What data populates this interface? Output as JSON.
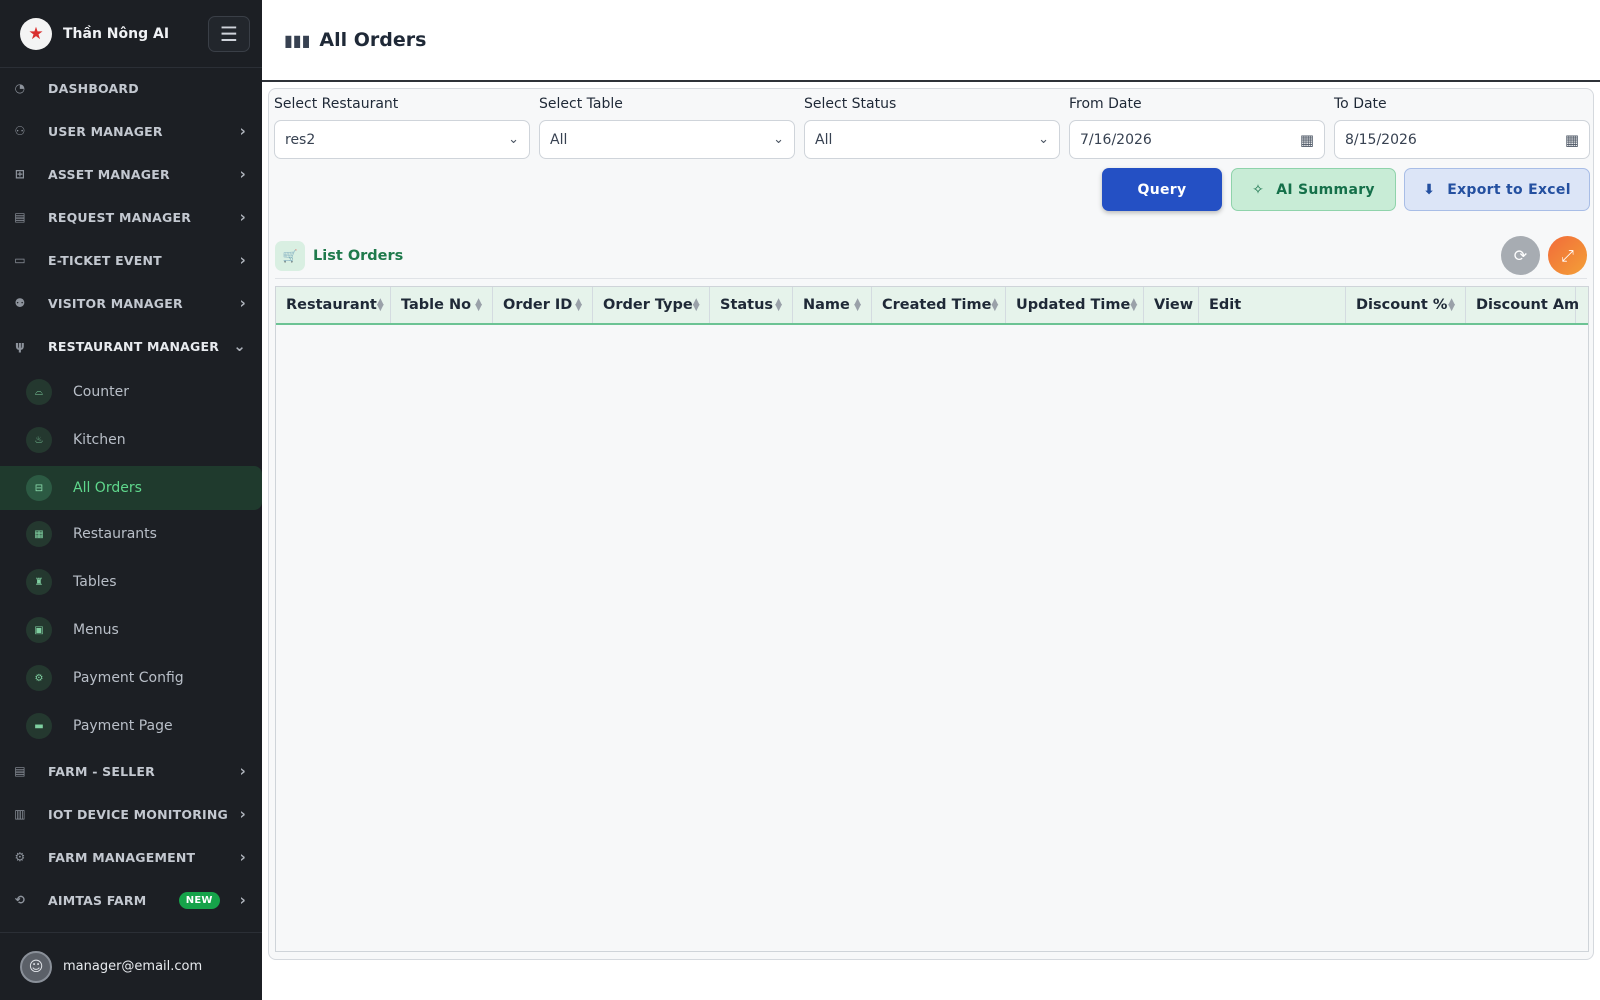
{
  "app": {
    "brand": "Thần Nông AI",
    "menu_icon": "hamburger-icon"
  },
  "sidebar": {
    "items": [
      {
        "label": "DASHBOARD",
        "icon": "dashboard-icon",
        "chevron": ""
      },
      {
        "label": "USER MANAGER",
        "icon": "users-icon",
        "chevron": "›"
      },
      {
        "label": "ASSET MANAGER",
        "icon": "asset-icon",
        "chevron": "›"
      },
      {
        "label": "REQUEST MANAGER",
        "icon": "clipboard-icon",
        "chevron": "›"
      },
      {
        "label": "E-TICKET EVENT",
        "icon": "ticket-icon",
        "chevron": "›"
      },
      {
        "label": "VISITOR MANAGER",
        "icon": "visitors-icon",
        "chevron": "›"
      },
      {
        "label": "RESTAURANT MANAGER",
        "icon": "utensils-icon",
        "chevron": "⌄"
      }
    ],
    "sub_items": [
      {
        "label": "Counter",
        "icon": "counter-icon"
      },
      {
        "label": "Kitchen",
        "icon": "kitchen-icon"
      },
      {
        "label": "All Orders",
        "icon": "orders-icon",
        "active": true
      },
      {
        "label": "Restaurants",
        "icon": "store-icon"
      },
      {
        "label": "Tables",
        "icon": "chair-icon"
      },
      {
        "label": "Menus",
        "icon": "menu-book-icon"
      },
      {
        "label": "Payment Config",
        "icon": "payment-config-icon"
      },
      {
        "label": "Payment Page",
        "icon": "credit-card-icon"
      }
    ],
    "bottom_items": [
      {
        "label": "FARM - SELLER",
        "icon": "farm-seller-icon",
        "chevron": "›"
      },
      {
        "label": "IOT DEVICE MONITORING",
        "icon": "iot-icon",
        "chevron": "›"
      },
      {
        "label": "FARM MANAGEMENT",
        "icon": "tractor-icon",
        "chevron": "›"
      },
      {
        "label": "AIMTAS FARM",
        "icon": "aimtas-icon",
        "chevron": "›",
        "badge": "NEW"
      }
    ],
    "user_email": "manager@email.com"
  },
  "header": {
    "title": "All Orders",
    "icon": "bar-chart-icon"
  },
  "filters": [
    {
      "label": "Select Restaurant",
      "value": "res2",
      "kind": "select"
    },
    {
      "label": "Select Table",
      "value": "All",
      "kind": "select"
    },
    {
      "label": "Select Status",
      "value": "All",
      "kind": "select"
    },
    {
      "label": "From Date",
      "value": "7/16/2026",
      "kind": "date"
    },
    {
      "label": "To Date",
      "value": "8/15/2026",
      "kind": "date"
    }
  ],
  "buttons": {
    "query": "Query",
    "ai_summary": "AI Summary",
    "export": "Export to Excel"
  },
  "list": {
    "title": "List Orders"
  },
  "table": {
    "columns": [
      "Restaurant",
      "Table No",
      "Order ID",
      "Order Type",
      "Status",
      "Name",
      "Created Time",
      "Updated Time",
      "View",
      "Edit",
      "Discount %",
      "Discount Am"
    ],
    "rows": []
  },
  "colors": {
    "accent_green": "#16a34a",
    "primary_blue": "#2450c4",
    "sidebar_bg": "#1c1f24"
  }
}
